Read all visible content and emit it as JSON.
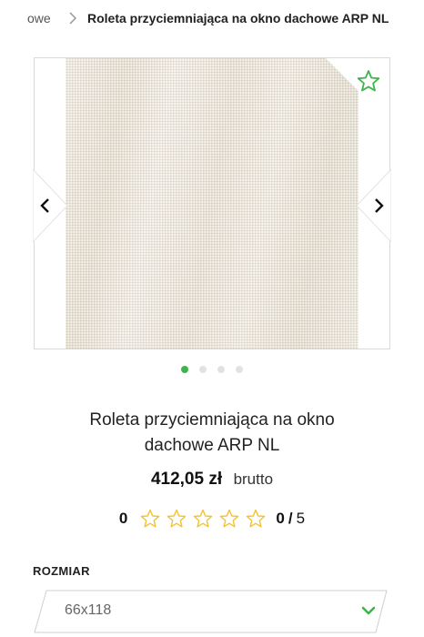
{
  "breadcrumb": {
    "previous": "owe",
    "current": "Roleta przyciemniająca na okno dachowe ARP NL"
  },
  "gallery": {
    "dots_total": 4,
    "active_dot": 1
  },
  "product": {
    "title": "Roleta przyciemniająca na okno dachowe ARP NL",
    "price": "412,05 zł",
    "price_note": "brutto"
  },
  "rating": {
    "count": "0",
    "score": "0",
    "separator": "/",
    "max": "5",
    "stars_filled": 0
  },
  "size": {
    "label": "ROZMIAR",
    "selected": "66x118"
  },
  "colors": {
    "accent": "#3db54a",
    "star_outline": "#f2c230"
  }
}
